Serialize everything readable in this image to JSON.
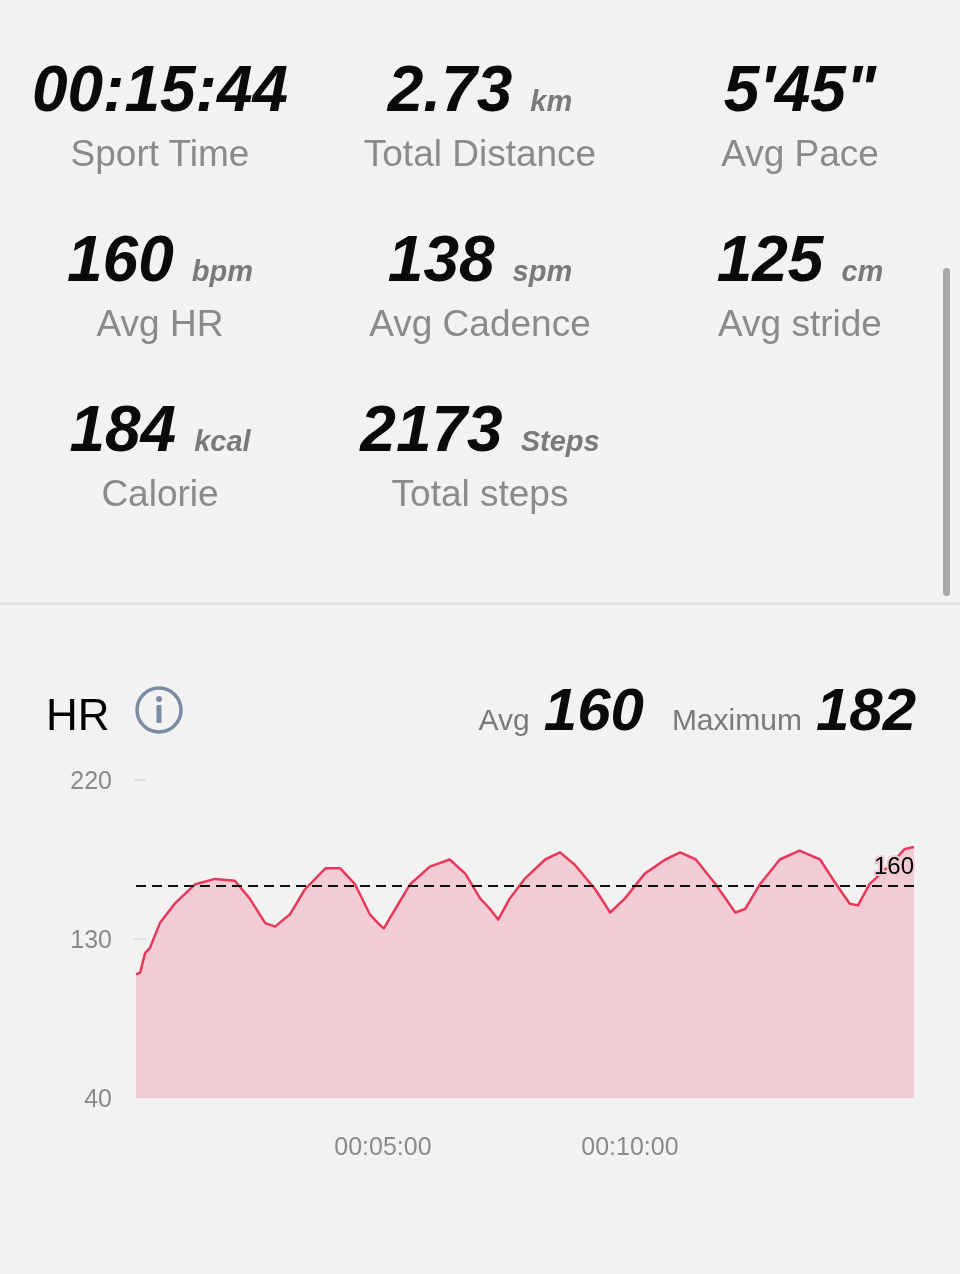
{
  "stats": [
    {
      "value": "00:15:44",
      "label": "Sport Time"
    },
    {
      "value": "2.73",
      "unit": "km",
      "label": "Total Distance"
    },
    {
      "value": "5'45\"",
      "label": "Avg Pace"
    },
    {
      "value": "160",
      "unit": "bpm",
      "label": "Avg HR"
    },
    {
      "value": "138",
      "unit": "spm",
      "label": "Avg Cadence"
    },
    {
      "value": "125",
      "unit": "cm",
      "label": "Avg stride"
    },
    {
      "value": "184",
      "unit": "kcal",
      "label": "Calorie"
    },
    {
      "value": "2173",
      "unit": "Steps",
      "label": "Total steps"
    }
  ],
  "hr": {
    "title": "HR",
    "avg_label": "Avg",
    "avg_value": "160",
    "max_label": "Maximum",
    "max_value": "182",
    "chart_data": {
      "type": "area",
      "xlim": [
        0,
        945
      ],
      "ylim": [
        40,
        220
      ],
      "yticks": [
        40,
        130,
        220
      ],
      "xticks": [
        {
          "value": 300,
          "label": "00:05:00"
        },
        {
          "value": 600,
          "label": "00:10:00"
        }
      ],
      "x": [
        0,
        5,
        11,
        17,
        29,
        47,
        72,
        96,
        120,
        138,
        157,
        169,
        187,
        205,
        230,
        248,
        266,
        284,
        294,
        301,
        315,
        333,
        357,
        381,
        400,
        418,
        430,
        440,
        454,
        472,
        497,
        515,
        533,
        558,
        576,
        594,
        618,
        643,
        661,
        680,
        704,
        728,
        740,
        758,
        782,
        806,
        831,
        849,
        867,
        877,
        891,
        916,
        934,
        945
      ],
      "series": [
        {
          "color": "#e8395a",
          "values": [
            110,
            111,
            122,
            125,
            139,
            150,
            161,
            164,
            163,
            153,
            139,
            137,
            144,
            158,
            170,
            170,
            161,
            144,
            139,
            136,
            147,
            161,
            171,
            175,
            167,
            153,
            147,
            141,
            153,
            164,
            175,
            179,
            172,
            158,
            145,
            153,
            167,
            175,
            179,
            175,
            161,
            145,
            147,
            161,
            175,
            180,
            175,
            162,
            150,
            149,
            161,
            172,
            181,
            182
          ]
        }
      ],
      "ref_lines": [
        {
          "axis": "y",
          "value": 160,
          "label": "160"
        }
      ]
    }
  }
}
